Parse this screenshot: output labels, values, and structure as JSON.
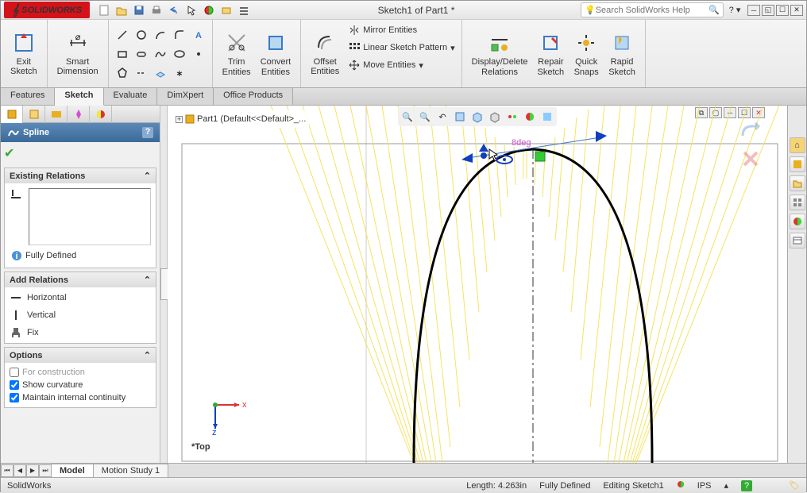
{
  "title": "Sketch1 of Part1 *",
  "brand": "SOLIDWORKS",
  "brand_prefix": "DS",
  "search": {
    "placeholder": "Search SolidWorks Help"
  },
  "ribbon": {
    "exit_sketch": "Exit\nSketch",
    "smart_dim": "Smart\nDimension",
    "trim": "Trim\nEntities",
    "convert": "Convert\nEntities",
    "offset": "Offset\nEntities",
    "mirror": "Mirror Entities",
    "linear": "Linear Sketch Pattern",
    "move": "Move Entities",
    "display_del": "Display/Delete\nRelations",
    "repair": "Repair\nSketch",
    "quick": "Quick\nSnaps",
    "rapid": "Rapid\nSketch"
  },
  "tabs": {
    "features": "Features",
    "sketch": "Sketch",
    "evaluate": "Evaluate",
    "dimxpert": "DimXpert",
    "office": "Office Products"
  },
  "pm": {
    "title": "Spline",
    "existing": "Existing Relations",
    "fully_defined": "Fully Defined",
    "add_rel": "Add Relations",
    "horizontal": "Horizontal",
    "vertical": "Vertical",
    "fix": "Fix",
    "options": "Options",
    "for_constr": "For construction",
    "show_curv": "Show curvature",
    "maintain": "Maintain internal continuity"
  },
  "tree": {
    "part": "Part1 (Default<<Default>_..."
  },
  "view_label": "*Top",
  "bottom_tabs": {
    "model": "Model",
    "motion": "Motion Study 1"
  },
  "status": {
    "app": "SolidWorks",
    "length": "Length: 4.263in",
    "defined": "Fully Defined",
    "editing": "Editing Sketch1",
    "units": "IPS"
  }
}
